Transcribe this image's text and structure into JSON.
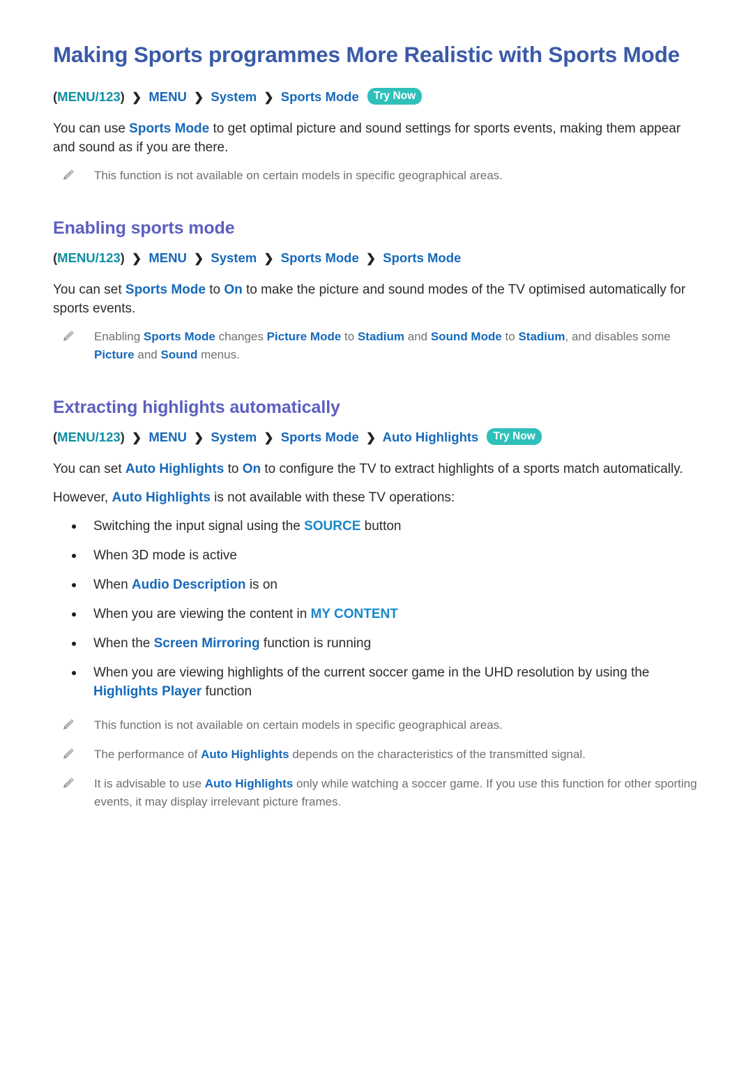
{
  "document": {
    "title": "Making Sports programmes More Realistic with Sports Mode"
  },
  "colors": {
    "title": "#3a5aa8",
    "heading": "#5d60bf",
    "link": "#1669bb",
    "key_teal": "#0f8fa4",
    "badge_bg": "#2fc0ba",
    "note_text": "#6f6f6f",
    "body_text": "#2b2b2b"
  },
  "breadcrumbs": {
    "top": {
      "key": "MENU/123",
      "open_paren": "(",
      "close_paren": ")",
      "separator": "❯",
      "items": [
        "MENU",
        "System",
        "Sports Mode"
      ],
      "try_now": "Try Now"
    },
    "enabling": {
      "key": "MENU/123",
      "open_paren": "(",
      "close_paren": ")",
      "separator": "❯",
      "items": [
        "MENU",
        "System",
        "Sports Mode",
        "Sports Mode"
      ],
      "try_now": ""
    },
    "extracting": {
      "key": "MENU/123",
      "open_paren": "(",
      "close_paren": ")",
      "separator": "❯",
      "items": [
        "MENU",
        "System",
        "Sports Mode",
        "Auto Highlights"
      ],
      "try_now": "Try Now"
    }
  },
  "intro": {
    "p1_a": "You can use ",
    "p1_term": "Sports Mode",
    "p1_b": " to get optimal picture and sound settings for sports events, making them appear and sound as if you are there.",
    "note1": "This function is not available on certain models in specific geographical areas."
  },
  "enabling_section": {
    "heading": "Enabling sports mode",
    "p1_a": "You can set ",
    "p1_term1": "Sports Mode",
    "p1_b": " to ",
    "p1_term2": "On",
    "p1_c": " to make the picture and sound modes of the TV optimised automatically for sports events.",
    "note_a": "Enabling ",
    "note_t1": "Sports Mode",
    "note_b": " changes ",
    "note_t2": "Picture Mode",
    "note_c": " to ",
    "note_t3": "Stadium",
    "note_d": " and ",
    "note_t4": "Sound Mode",
    "note_e": " to ",
    "note_t5": "Stadium",
    "note_f": ", and disables some ",
    "note_t6": "Picture",
    "note_g": " and ",
    "note_t7": "Sound",
    "note_h": " menus."
  },
  "extracting_section": {
    "heading": "Extracting highlights automatically",
    "p1_a": "You can set ",
    "p1_term1": "Auto Highlights",
    "p1_b": " to ",
    "p1_term2": "On",
    "p1_c": " to configure the TV to extract highlights of a sports match automatically.",
    "p2_a": "However, ",
    "p2_term": "Auto Highlights",
    "p2_b": " is not available with these TV operations:",
    "bullets": [
      {
        "pre": "Switching the input signal using the ",
        "term": "SOURCE",
        "term_style": "cyan",
        "post": " button"
      },
      {
        "pre": "When 3D mode is active",
        "term": "",
        "term_style": "none",
        "post": ""
      },
      {
        "pre": "When ",
        "term": "Audio Description",
        "term_style": "blue",
        "post": " is on"
      },
      {
        "pre": "When you are viewing the content in ",
        "term": "MY CONTENT",
        "term_style": "cyan-bold",
        "post": ""
      },
      {
        "pre": "When the ",
        "term": "Screen Mirroring",
        "term_style": "blue-bold",
        "post": " function is running"
      },
      {
        "pre": "When you are viewing highlights of the current soccer game in the UHD resolution by using the ",
        "term": "Highlights Player",
        "term_style": "blue-bold",
        "post": " function"
      }
    ],
    "note1": "This function is not available on certain models in specific geographical areas.",
    "note2_a": "The performance of ",
    "note2_term": "Auto Highlights",
    "note2_b": " depends on the characteristics of the transmitted signal.",
    "note3_a": "It is advisable to use ",
    "note3_term": "Auto Highlights",
    "note3_b": " only while watching a soccer game. If you use this function for other sporting events, it may display irrelevant picture frames."
  },
  "icons": {
    "note_icon": "pencil-icon",
    "breadcrumb_separator_icon": "chevron-right-icon",
    "bullet_icon": "bullet-dot-icon"
  }
}
